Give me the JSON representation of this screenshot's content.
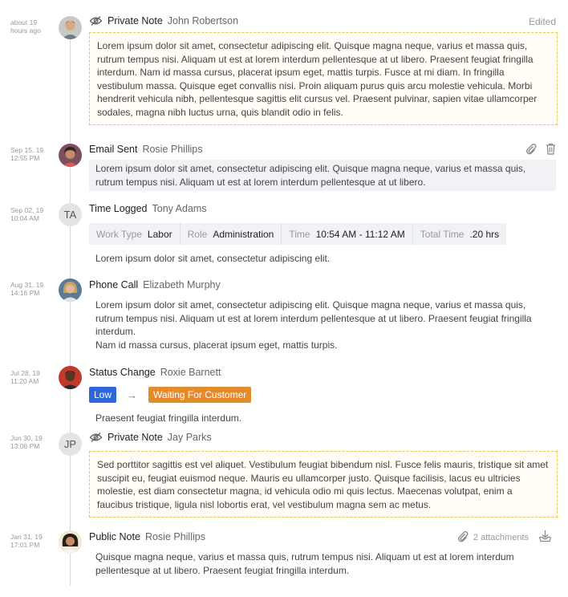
{
  "entries": [
    {
      "time": [
        "about 19",
        "hours ago"
      ],
      "type": "Private Note",
      "person": "John Robertson",
      "status": "Edited",
      "body": "Lorem ipsum dolor sit amet, consectetur adipiscing elit. Quisque magna neque, varius et massa quis, rutrum tempus nisi. Aliquam ut est at lorem interdum pellentesque at ut libero. Praesent feugiat fringilla interdum. Nam id massa cursus, placerat ipsum eget, mattis turpis. Fusce at mi diam. In fringilla vestibulum massa. Quisque eget convallis nisi. Proin aliquam purus quis arcu molestie vehicula. Morbi hendrerit vehicula nibh, pellentesque sagittis elit cursus vel. Praesent pulvinar, sapien vitae ullamcorper sodales, magna nibh luctus urna, quis blandit odio in felis."
    },
    {
      "time": [
        "Sep 15, 19",
        "12:55 PM"
      ],
      "type": "Email Sent",
      "person": "Rosie Phillips",
      "body": "Lorem ipsum dolor sit amet, consectetur adipiscing elit. Quisque magna neque, varius et massa quis, rutrum tempus nisi. Aliquam ut est at lorem interdum pellentesque at ut libero."
    },
    {
      "time": [
        "Sep 02, 19",
        "10:04 AM"
      ],
      "type": "Time Logged",
      "person": "Tony Adams",
      "initials": "TA",
      "worklog": [
        {
          "key": "Work Type",
          "value": "Labor"
        },
        {
          "key": "Role",
          "value": "Administration"
        },
        {
          "key": "Time",
          "value": "10:54 AM - 11:12 AM"
        },
        {
          "key": "Total Time",
          "value": ".20 hrs"
        }
      ],
      "body": "Lorem ipsum dolor sit amet, consectetur adipiscing elit."
    },
    {
      "time": [
        "Aug 31, 19",
        "14:16 PM"
      ],
      "type": "Phone Call",
      "person": "Elizabeth Murphy",
      "body_lines": [
        "Lorem ipsum dolor sit amet, consectetur adipiscing elit. Quisque magna neque, varius et massa quis, rutrum tempus nisi. Aliquam ut est at lorem interdum pellentesque at ut libero. Praesent feugiat fringilla interdum.",
        "Nam id massa cursus, placerat ipsum eget, mattis turpis."
      ]
    },
    {
      "time": [
        "Jul 28, 19",
        "11:20 AM"
      ],
      "type": "Status Change",
      "person": "Roxie Barnett",
      "from_status": "Low",
      "to_status": "Waiting For Customer",
      "body": "Praesent feugiat fringilla interdum."
    },
    {
      "time": [
        "Jun 30, 19",
        "13:06 PM"
      ],
      "type": "Private Note",
      "person": "Jay Parks",
      "initials": "JP",
      "body": "Sed porttitor sagittis est vel aliquet. Vestibulum feugiat bibendum nisl. Fusce felis mauris, tristique sit amet suscipit eu, feugiat euismod neque. Mauris eu ullamcorper justo. Quisque facilisis, lacus eu ultricies molestie, est diam consectetur magna, id vehicula odio mi quis lectus. Maecenas volutpat, enim a faucibus tristique, ligula nisl lobortis erat, vel vestibulum magna sem ac metus."
    },
    {
      "time": [
        "Jan 31, 19",
        "17:01 PM"
      ],
      "type": "Public Note",
      "person": "Rosie Phillips",
      "attachments": "2 attachments",
      "body": "Quisque magna neque, varius et massa quis, rutrum tempus nisi. Aliquam ut est at lorem interdum pellentesque at ut libero. Praesent feugiat fringilla interdum."
    }
  ],
  "colors": {
    "accent_low": "#2f66d8",
    "status_waiting": "#e48c2c",
    "private_border": "#f0c44a"
  },
  "icons": {
    "private": "eye-off-icon",
    "attach": "paperclip-icon",
    "delete": "trash-icon",
    "download": "download-icon",
    "arrow": "arrow-right-icon"
  }
}
